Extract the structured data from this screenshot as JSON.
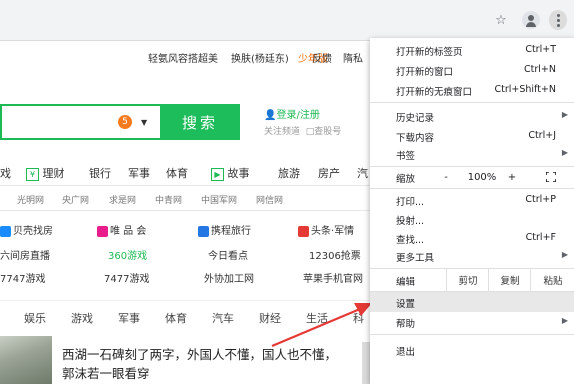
{
  "browser": {
    "star_icon": "star-icon",
    "profile_icon": "profile-icon",
    "menu_icon": "more-vert-icon"
  },
  "page": {
    "toplinks": [
      "轻氨风容搭超美",
      "换肤(杨廷东)",
      "少年版",
      "反馈",
      "隋私"
    ],
    "search": {
      "badge": "5",
      "button": "搜索"
    },
    "login": {
      "title": "登录/注册",
      "sub1": "关注频道",
      "sub2": "查股号"
    },
    "nav": [
      "戏",
      "理财",
      "银行",
      "军事",
      "体育",
      "故事",
      "旅游",
      "房产",
      "汽"
    ],
    "links": [
      "光明网",
      "央广网",
      "求是网",
      "中青网",
      "中国军网",
      "网信网"
    ],
    "sites_row1": [
      "贝壳找房",
      "唯 品 会",
      "携程旅行",
      "头条·军情"
    ],
    "sites_row2": [
      "六间房直播",
      "360游戏",
      "今日看点",
      "12306抢票"
    ],
    "sites_row3": [
      "7747游戏",
      "7477游戏",
      "外协加工网",
      "苹果手机官网"
    ],
    "tabs": [
      "娱乐",
      "游戏",
      "军事",
      "体育",
      "汽车",
      "财经",
      "生活",
      "科"
    ],
    "headline1": "西湖一石碑刻了两字，外国人不懂，国人也不懂，",
    "headline2": "郭沫若一眼看穿",
    "colors": {
      "green": "#1db954",
      "orange": "#f47b20",
      "red_label": "#ff6600",
      "arrow": "#e53935"
    }
  },
  "menu": {
    "new_tab": {
      "label": "打开新的标签页",
      "shortcut": "Ctrl+T"
    },
    "new_window": {
      "label": "打开新的窗口",
      "shortcut": "Ctrl+N"
    },
    "new_incognito": {
      "label": "打开新的无痕窗口",
      "shortcut": "Ctrl+Shift+N"
    },
    "history": {
      "label": "历史记录"
    },
    "downloads": {
      "label": "下载内容",
      "shortcut": "Ctrl+J"
    },
    "bookmarks": {
      "label": "书签"
    },
    "zoom": {
      "label": "缩放",
      "minus": "-",
      "value": "100%",
      "plus": "+"
    },
    "print": {
      "label": "打印...",
      "shortcut": "Ctrl+P"
    },
    "cast": {
      "label": "投射..."
    },
    "find": {
      "label": "查找...",
      "shortcut": "Ctrl+F"
    },
    "more_tools": {
      "label": "更多工具"
    },
    "edit": {
      "label": "编辑",
      "cut": "剪切",
      "copy": "复制",
      "paste": "粘贴"
    },
    "settings": {
      "label": "设置"
    },
    "help": {
      "label": "帮助"
    },
    "exit": {
      "label": "退出"
    }
  }
}
